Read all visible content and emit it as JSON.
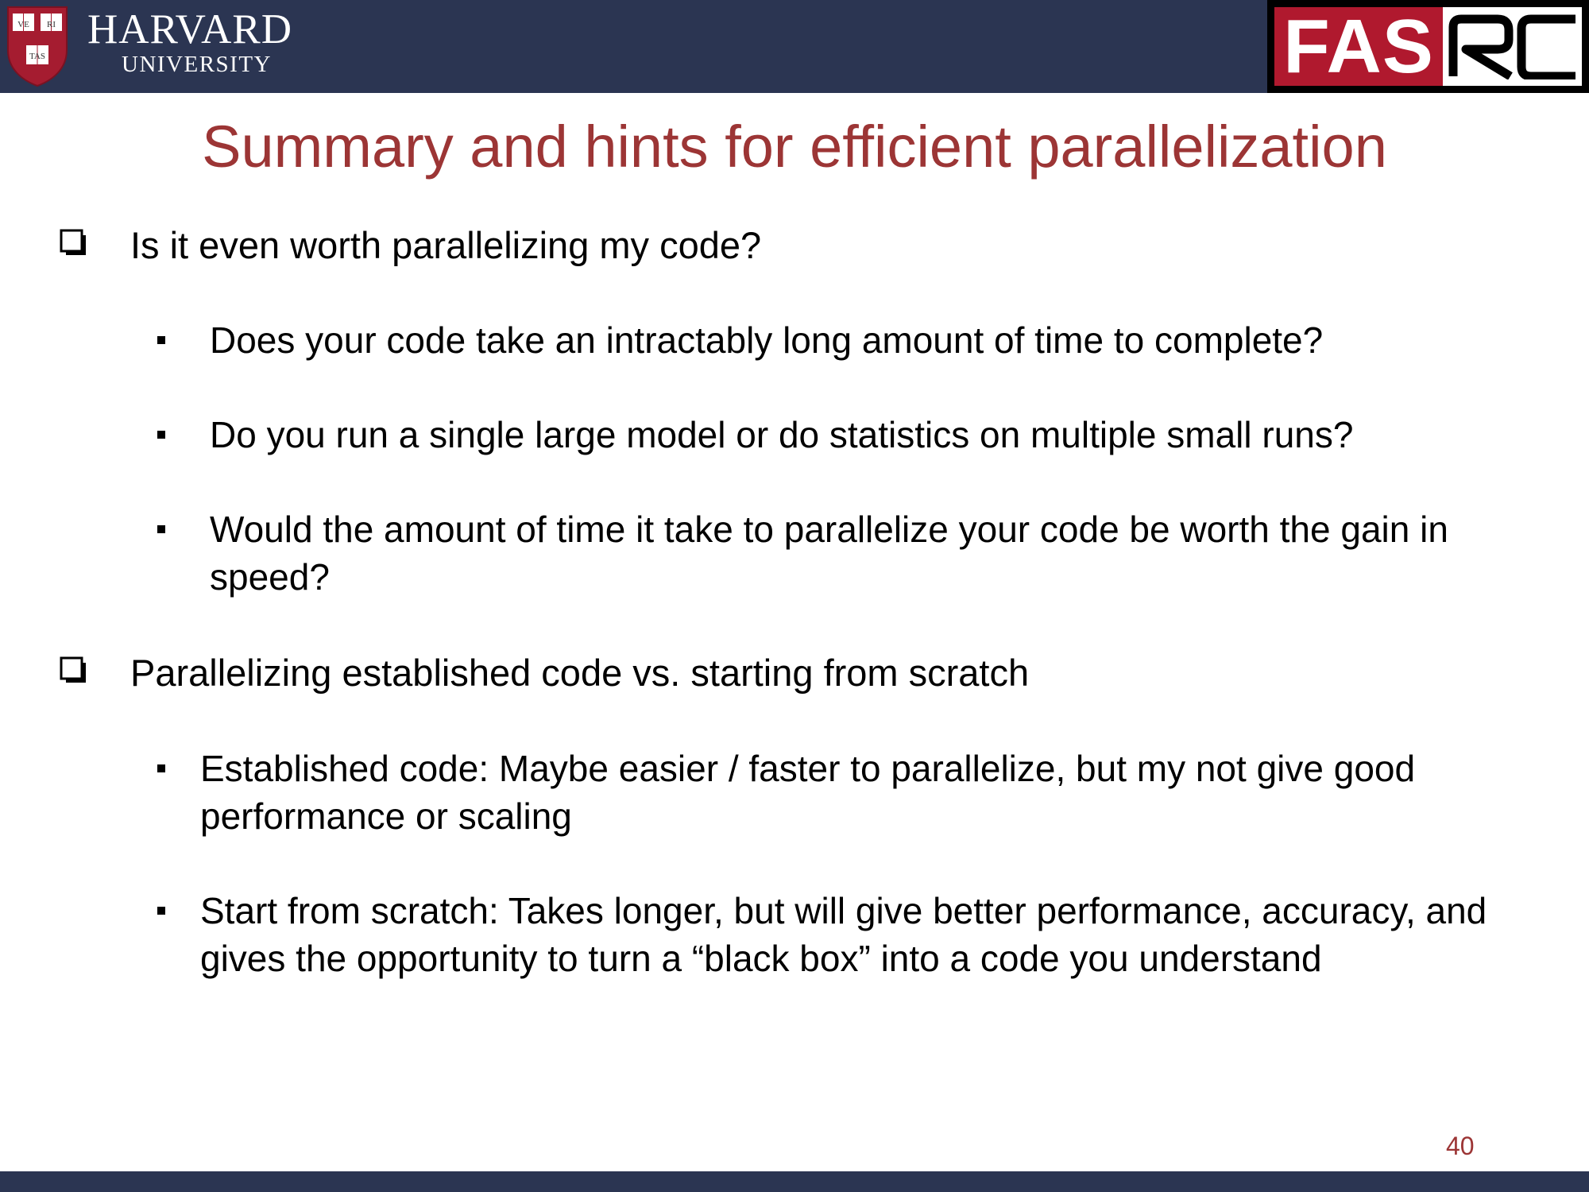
{
  "header": {
    "institution_name": "HARVARD",
    "institution_sub": "UNIVERSITY",
    "shield_text": [
      "VE",
      "RI",
      "TAS"
    ],
    "fasrc_logo": {
      "part1": "FAS",
      "part2": "RC"
    },
    "bg_color": "#2b3552"
  },
  "slide": {
    "title": "Summary and hints for efficient parallelization",
    "title_color": "#9c3535",
    "sections": [
      {
        "heading": "Is it even worth parallelizing my code?",
        "bullets": [
          "Does your code take an intractably long amount of time to complete?",
          "Do you run a single large model or do statistics on multiple small runs?",
          "Would the amount of time it take to parallelize your code be worth the gain in speed?"
        ]
      },
      {
        "heading": "Parallelizing established code vs. starting from scratch",
        "bullets": [
          "Established code: Maybe easier / faster to parallelize, but my not give good performance or scaling",
          "Start from scratch: Takes longer, but will give better performance, accuracy, and gives the opportunity to turn a “black box” into a code you understand"
        ]
      }
    ],
    "page_number": "40"
  },
  "icons": {
    "checkbox": "checkbox-icon",
    "bullet": "square-bullet-icon"
  }
}
